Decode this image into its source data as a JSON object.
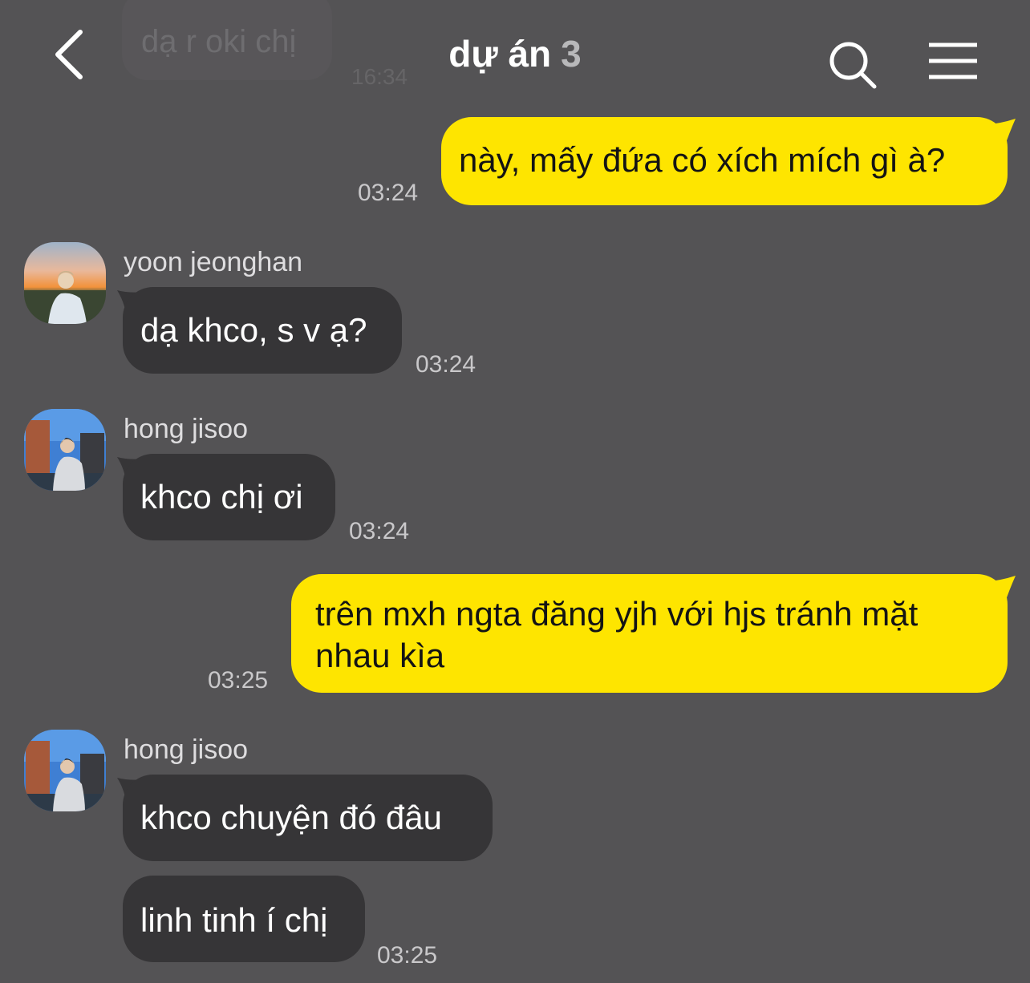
{
  "header": {
    "back_icon": "chevron-left-icon",
    "title": "dự án",
    "member_count": "3",
    "search_icon": "search-icon",
    "menu_icon": "hamburger-menu-icon"
  },
  "ghost_message": {
    "text": "dạ r oki chị",
    "time": "16:34"
  },
  "colors": {
    "background": "#545355",
    "outgoing": "#fee500",
    "incoming": "#363537"
  },
  "messages": [
    {
      "direction": "out",
      "lines": [
        "này, mấy đứa có xích mích gì à?"
      ],
      "time": "03:24"
    },
    {
      "direction": "in",
      "sender": "yoon jeonghan",
      "avatar": "sunset-profile-photo",
      "lines": [
        "dạ khco, s v ạ?"
      ],
      "time": "03:24"
    },
    {
      "direction": "in",
      "sender": "hong jisoo",
      "avatar": "city-profile-photo",
      "lines": [
        "khco chị ơi"
      ],
      "time": "03:24"
    },
    {
      "direction": "out",
      "lines": [
        "trên mxh ngta đăng yjh với hjs tránh mặt",
        "nhau kìa"
      ],
      "time": "03:25"
    },
    {
      "direction": "in",
      "sender": "hong jisoo",
      "avatar": "city-profile-photo",
      "lines": [
        "khco chuyện đó đâu"
      ],
      "time": ""
    },
    {
      "direction": "in",
      "sender": "",
      "lines": [
        "linh tinh í chị"
      ],
      "time": "03:25"
    }
  ]
}
